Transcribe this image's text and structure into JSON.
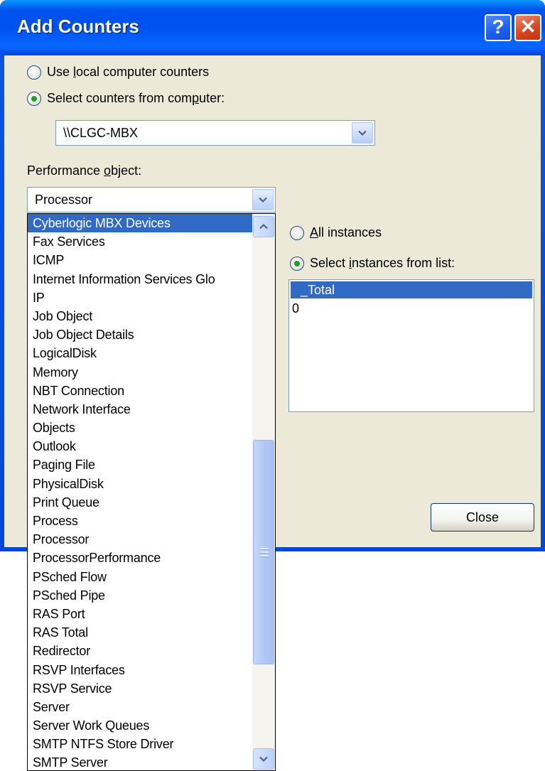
{
  "window": {
    "title": "Add Counters",
    "help_label": "?",
    "close_glyph": "✕"
  },
  "computer_source": {
    "local_option": {
      "before": "Use ",
      "accel": "l",
      "after": "ocal computer counters"
    },
    "remote_option": {
      "before": "Select counters from com",
      "accel": "p",
      "after": "uter:"
    },
    "selected": "remote",
    "computer_value": "\\\\CLGC-MBX"
  },
  "performance_object": {
    "label": {
      "before": "Performance ",
      "accel": "o",
      "after": "bject:"
    },
    "value": "Processor",
    "dropdown_open": true,
    "selected_item": "Cyberlogic MBX Devices",
    "items": [
      "Cyberlogic MBX Devices",
      "Fax Services",
      "ICMP",
      "Internet Information Services Glo",
      "IP",
      "Job Object",
      "Job Object Details",
      "LogicalDisk",
      "Memory",
      "NBT Connection",
      "Network Interface",
      "Objects",
      "Outlook",
      "Paging File",
      "PhysicalDisk",
      "Print Queue",
      "Process",
      "Processor",
      "ProcessorPerformance",
      "PSched Flow",
      "PSched Pipe",
      "RAS Port",
      "RAS Total",
      "Redirector",
      "RSVP Interfaces",
      "RSVP Service",
      "Server",
      "Server Work Queues",
      "SMTP NTFS Store Driver",
      "SMTP Server"
    ]
  },
  "instances": {
    "all_option": {
      "before": "",
      "accel": "A",
      "after": "ll instances"
    },
    "list_option": {
      "before": "Select ",
      "accel": "i",
      "after": "nstances from list:"
    },
    "selected": "list",
    "items": [
      "_Total",
      "0"
    ],
    "selected_item": "_Total"
  },
  "buttons": {
    "close_label": "Close"
  },
  "icons": {
    "combo_arrow": "chevron-down-icon",
    "scroll_up": "chevron-up-icon",
    "scroll_down": "chevron-down-icon",
    "help": "help-icon",
    "close": "close-icon"
  },
  "colors": {
    "titlebar": "#0054e3",
    "selection": "#316ac5",
    "dialog_face": "#ece9d8",
    "radio_dot": "#21a121"
  }
}
